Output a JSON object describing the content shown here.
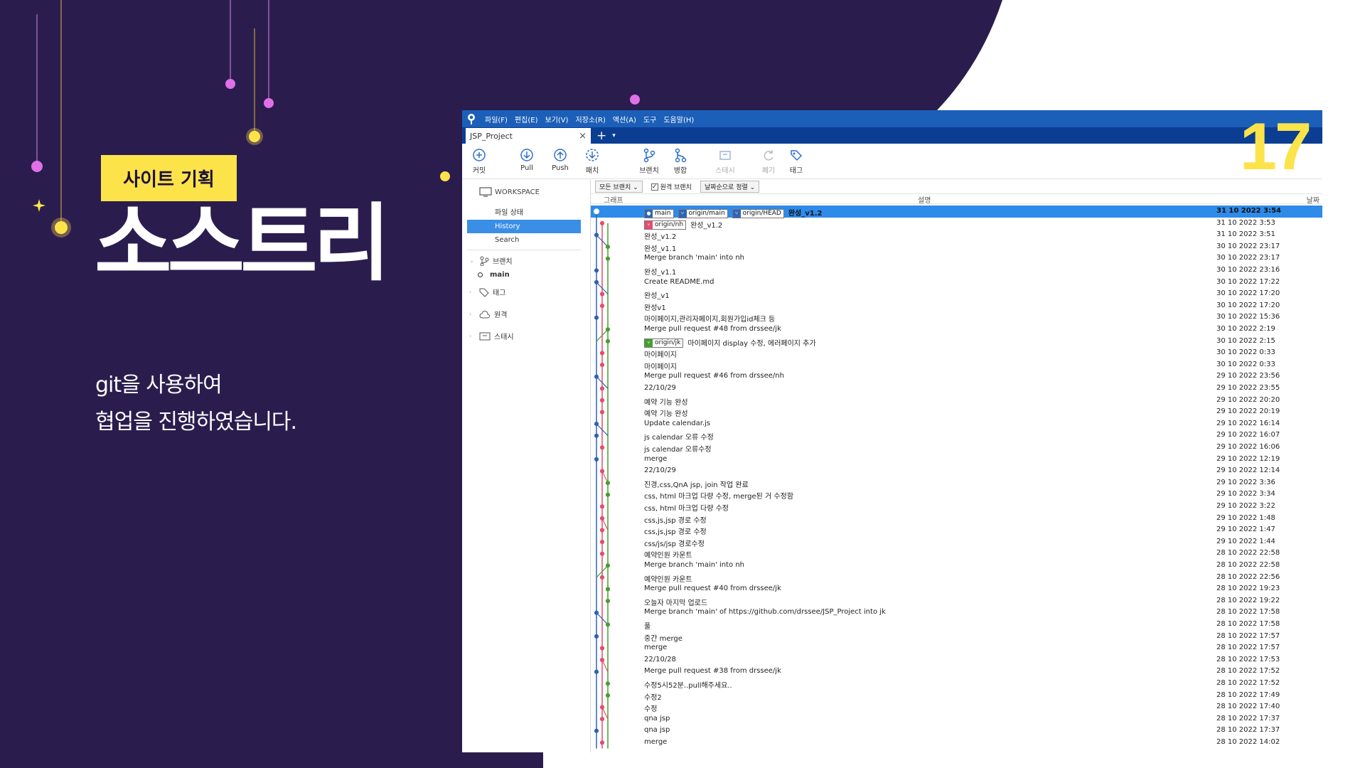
{
  "slide": {
    "page_number": "17",
    "badge": "사이트 기획",
    "title": "소스트리",
    "description_lines": [
      "git을 사용하여",
      "협업을 진행하였습니다."
    ],
    "colors": {
      "background": "#2a1d4e",
      "accent": "#fce34a",
      "app_blue": "#1b5fb8"
    }
  },
  "app": {
    "menu": [
      "파일(F)",
      "편집(E)",
      "보기(V)",
      "저장소(R)",
      "액션(A)",
      "도구",
      "도움말(H)"
    ],
    "tab": {
      "label": "JSP_Project",
      "close": "×",
      "add": "+",
      "dropdown": "▾"
    },
    "toolbar": [
      {
        "label": "커밋",
        "icon": "commit-icon",
        "enabled": true
      },
      {
        "label": "Pull",
        "icon": "pull-icon",
        "enabled": true
      },
      {
        "label": "Push",
        "icon": "push-icon",
        "enabled": true
      },
      {
        "label": "패치",
        "icon": "fetch-icon",
        "enabled": true
      },
      {
        "label": "브랜치",
        "icon": "branch-icon",
        "enabled": true
      },
      {
        "label": "병합",
        "icon": "merge-icon",
        "enabled": true
      },
      {
        "label": "스태시",
        "icon": "stash-icon",
        "enabled": false
      },
      {
        "label": "폐기",
        "icon": "discard-icon",
        "enabled": false
      },
      {
        "label": "태그",
        "icon": "tag-icon",
        "enabled": true
      }
    ],
    "sidebar": {
      "workspace": "WORKSPACE",
      "file_status": "파일 상태",
      "history": "History",
      "search": "Search",
      "branches": "브랜치",
      "main_branch": "main",
      "tags": "태그",
      "remotes": "원격",
      "stashes": "스태시"
    },
    "filters": {
      "branches": "모든 브랜치",
      "remote_branches": "원격 브랜치",
      "remote_checked": true,
      "sort": "날짜순으로 정렬"
    },
    "columns": {
      "graph": "그래프",
      "description": "설명",
      "date": "날짜"
    },
    "commits": [
      {
        "refs": [
          {
            "name": "main",
            "type": "local"
          },
          {
            "name": "origin/main",
            "type": "remote"
          },
          {
            "name": "origin/HEAD",
            "type": "remote"
          }
        ],
        "message": "완성_v1.2",
        "date": "31 10 2022 3:54",
        "selected": true
      },
      {
        "refs": [
          {
            "name": "origin/nh",
            "type": "remote-nh"
          }
        ],
        "message": "완성_v1.2",
        "date": "31 10 2022 3:53"
      },
      {
        "message": "완성_v1.2",
        "date": "31 10 2022 3:51"
      },
      {
        "message": "완성_v1.1",
        "date": "30 10 2022 23:17"
      },
      {
        "message": "Merge branch 'main' into nh",
        "date": "30 10 2022 23:17"
      },
      {
        "message": "완성_v1.1",
        "date": "30 10 2022 23:16"
      },
      {
        "message": "Create README.md",
        "date": "30 10 2022 17:22"
      },
      {
        "message": "완성_v1",
        "date": "30 10 2022 17:20"
      },
      {
        "message": "완성v1",
        "date": "30 10 2022 17:20"
      },
      {
        "message": "마이페이지,관리자페이지,회원가입id체크 등",
        "date": "30 10 2022 15:36"
      },
      {
        "message": "Merge pull request #48 from drssee/jk",
        "date": "30 10 2022 2:19"
      },
      {
        "refs": [
          {
            "name": "origin/jk",
            "type": "remote-jk"
          }
        ],
        "message": "마이페이지 display 수정, 에러페이지 추가",
        "date": "30 10 2022 2:15"
      },
      {
        "message": "마이페이지",
        "date": "30 10 2022 0:33"
      },
      {
        "message": "마이페이지",
        "date": "30 10 2022 0:33"
      },
      {
        "message": "Merge pull request #46 from drssee/nh",
        "date": "29 10 2022 23:56"
      },
      {
        "message": "22/10/29",
        "date": "29 10 2022 23:55"
      },
      {
        "message": "예약 기능 완성",
        "date": "29 10 2022 20:20"
      },
      {
        "message": "예약 기능 완성",
        "date": "29 10 2022 20:19"
      },
      {
        "message": "Update calendar.js",
        "date": "29 10 2022 16:14"
      },
      {
        "message": "js calendar 오류 수정",
        "date": "29 10 2022 16:07"
      },
      {
        "message": "js calendar 오류수정",
        "date": "29 10 2022 16:06"
      },
      {
        "message": "merge",
        "date": "29 10 2022 12:19"
      },
      {
        "message": "22/10/29",
        "date": "29 10 2022 12:14"
      },
      {
        "message": "진경,css,QnA jsp, join 작업 완료",
        "date": "29 10 2022 3:36"
      },
      {
        "message": "css, html 마크업 다량 수정, merge된 거 수정함",
        "date": "29 10 2022 3:34"
      },
      {
        "message": "css, html 마크업 다량 수정",
        "date": "29 10 2022 3:22"
      },
      {
        "message": "css,js,jsp 경로 수정",
        "date": "29 10 2022 1:48"
      },
      {
        "message": "css,js,jsp 경로 수정",
        "date": "29 10 2022 1:47"
      },
      {
        "message": "css/js/jsp 경로수정",
        "date": "29 10 2022 1:44"
      },
      {
        "message": "예약인원 카운트",
        "date": "28 10 2022 22:58"
      },
      {
        "message": "Merge branch 'main' into nh",
        "date": "28 10 2022 22:58"
      },
      {
        "message": "예약인원 카운트",
        "date": "28 10 2022 22:56"
      },
      {
        "message": "Merge pull request #40 from drssee/jk",
        "date": "28 10 2022 19:23"
      },
      {
        "message": "오늘자 마지막 업로드",
        "date": "28 10 2022 19:22"
      },
      {
        "message": "Merge branch 'main' of https://github.com/drssee/JSP_Project into jk",
        "date": "28 10 2022 17:58"
      },
      {
        "message": "풀",
        "date": "28 10 2022 17:58"
      },
      {
        "message": "중간 merge",
        "date": "28 10 2022 17:57"
      },
      {
        "message": "merge",
        "date": "28 10 2022 17:57"
      },
      {
        "message": "22/10/28",
        "date": "28 10 2022 17:53"
      },
      {
        "message": "Merge pull request #38 from drssee/jk",
        "date": "28 10 2022 17:52"
      },
      {
        "message": "수정5시52분..pull해주세요..",
        "date": "28 10 2022 17:52"
      },
      {
        "message": "수정2",
        "date": "28 10 2022 17:49"
      },
      {
        "message": "수정",
        "date": "28 10 2022 17:40"
      },
      {
        "message": "qna jsp",
        "date": "28 10 2022 17:37"
      },
      {
        "message": "qna jsp",
        "date": "28 10 2022 17:37"
      },
      {
        "message": "merge",
        "date": "28 10 2022 14:02"
      }
    ]
  }
}
